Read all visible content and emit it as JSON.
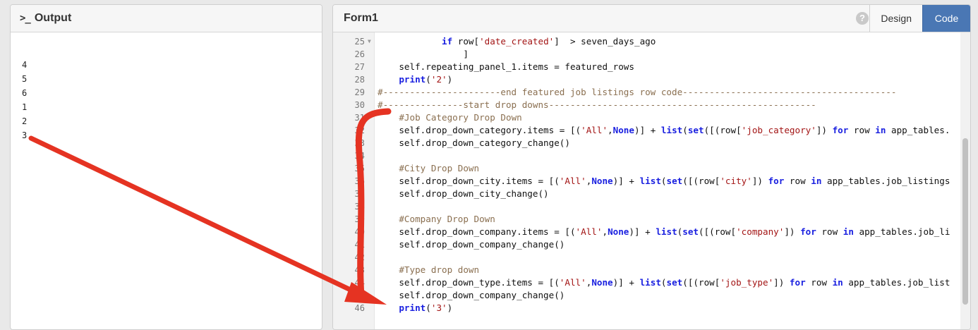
{
  "output": {
    "icon": ">_",
    "title": "Output",
    "lines": [
      "4",
      "5",
      "6",
      "1",
      "2",
      "3"
    ]
  },
  "form": {
    "title": "Form1",
    "help_icon": "?",
    "tabs": [
      {
        "label": "Design",
        "active": false
      },
      {
        "label": "Code",
        "active": true
      }
    ]
  },
  "editor": {
    "lines": [
      {
        "n": "25",
        "fold": true,
        "tokens": [
          [
            "txt",
            "            "
          ],
          [
            "kw",
            "if"
          ],
          [
            "txt",
            " row["
          ],
          [
            "str",
            "'date_created'"
          ],
          [
            "txt",
            "]  > seven_days_ago"
          ]
        ]
      },
      {
        "n": "26",
        "tokens": [
          [
            "txt",
            "                ]"
          ]
        ]
      },
      {
        "n": "27",
        "tokens": [
          [
            "txt",
            "    self.repeating_panel_1.items = featured_rows"
          ]
        ]
      },
      {
        "n": "28",
        "tokens": [
          [
            "txt",
            "    "
          ],
          [
            "fn",
            "print"
          ],
          [
            "txt",
            "("
          ],
          [
            "str",
            "'2'"
          ],
          [
            "txt",
            ")"
          ]
        ]
      },
      {
        "n": "29",
        "tokens": [
          [
            "cm",
            "#----------------------end featured job listings row code----------------------------------------"
          ]
        ]
      },
      {
        "n": "30",
        "tokens": [
          [
            "cm",
            "#---------------start drop downs--------------------------------------------------"
          ]
        ]
      },
      {
        "n": "31",
        "tokens": [
          [
            "txt",
            "    "
          ],
          [
            "cm",
            "#Job Category Drop Down"
          ]
        ]
      },
      {
        "n": "32",
        "tokens": [
          [
            "txt",
            "    self.drop_down_category.items = [("
          ],
          [
            "str",
            "'All'"
          ],
          [
            "txt",
            ","
          ],
          [
            "kw",
            "None"
          ],
          [
            "txt",
            ")] + "
          ],
          [
            "fn",
            "list"
          ],
          [
            "txt",
            "("
          ],
          [
            "fn",
            "set"
          ],
          [
            "txt",
            "([(row["
          ],
          [
            "str",
            "'job_category'"
          ],
          [
            "txt",
            "]) "
          ],
          [
            "kw",
            "for"
          ],
          [
            "txt",
            " row "
          ],
          [
            "kw",
            "in"
          ],
          [
            "txt",
            " app_tables."
          ]
        ]
      },
      {
        "n": "33",
        "tokens": [
          [
            "txt",
            "    self.drop_down_category_change()"
          ]
        ]
      },
      {
        "n": "34",
        "tokens": []
      },
      {
        "n": "35",
        "tokens": [
          [
            "txt",
            "    "
          ],
          [
            "cm",
            "#City Drop Down"
          ]
        ]
      },
      {
        "n": "36",
        "tokens": [
          [
            "txt",
            "    self.drop_down_city.items = [("
          ],
          [
            "str",
            "'All'"
          ],
          [
            "txt",
            ","
          ],
          [
            "kw",
            "None"
          ],
          [
            "txt",
            ")] + "
          ],
          [
            "fn",
            "list"
          ],
          [
            "txt",
            "("
          ],
          [
            "fn",
            "set"
          ],
          [
            "txt",
            "([(row["
          ],
          [
            "str",
            "'city'"
          ],
          [
            "txt",
            "]) "
          ],
          [
            "kw",
            "for"
          ],
          [
            "txt",
            " row "
          ],
          [
            "kw",
            "in"
          ],
          [
            "txt",
            " app_tables.job_listings"
          ]
        ]
      },
      {
        "n": "37",
        "tokens": [
          [
            "txt",
            "    self.drop_down_city_change()"
          ]
        ]
      },
      {
        "n": "38",
        "tokens": []
      },
      {
        "n": "39",
        "tokens": [
          [
            "txt",
            "    "
          ],
          [
            "cm",
            "#Company Drop Down"
          ]
        ]
      },
      {
        "n": "40",
        "tokens": [
          [
            "txt",
            "    self.drop_down_company.items = [("
          ],
          [
            "str",
            "'All'"
          ],
          [
            "txt",
            ","
          ],
          [
            "kw",
            "None"
          ],
          [
            "txt",
            ")] + "
          ],
          [
            "fn",
            "list"
          ],
          [
            "txt",
            "("
          ],
          [
            "fn",
            "set"
          ],
          [
            "txt",
            "([(row["
          ],
          [
            "str",
            "'company'"
          ],
          [
            "txt",
            "]) "
          ],
          [
            "kw",
            "for"
          ],
          [
            "txt",
            " row "
          ],
          [
            "kw",
            "in"
          ],
          [
            "txt",
            " app_tables.job_li"
          ]
        ]
      },
      {
        "n": "41",
        "tokens": [
          [
            "txt",
            "    self.drop_down_company_change()"
          ]
        ]
      },
      {
        "n": "42",
        "tokens": []
      },
      {
        "n": "43",
        "tokens": [
          [
            "txt",
            "    "
          ],
          [
            "cm",
            "#Type drop down"
          ]
        ]
      },
      {
        "n": "44",
        "tokens": [
          [
            "txt",
            "    self.drop_down_type.items = [("
          ],
          [
            "str",
            "'All'"
          ],
          [
            "txt",
            ","
          ],
          [
            "kw",
            "None"
          ],
          [
            "txt",
            ")] + "
          ],
          [
            "fn",
            "list"
          ],
          [
            "txt",
            "("
          ],
          [
            "fn",
            "set"
          ],
          [
            "txt",
            "([(row["
          ],
          [
            "str",
            "'job_type'"
          ],
          [
            "txt",
            "]) "
          ],
          [
            "kw",
            "for"
          ],
          [
            "txt",
            " row "
          ],
          [
            "kw",
            "in"
          ],
          [
            "txt",
            " app_tables.job_list"
          ]
        ]
      },
      {
        "n": "45",
        "tokens": [
          [
            "txt",
            "    self.drop_down_company_change()"
          ]
        ]
      },
      {
        "n": "46",
        "tokens": [
          [
            "txt",
            "    "
          ],
          [
            "fn",
            "print"
          ],
          [
            "txt",
            "("
          ],
          [
            "str",
            "'3'"
          ],
          [
            "txt",
            ")"
          ]
        ]
      }
    ]
  },
  "colors": {
    "keyword": "#1a20e0",
    "string": "#a31515",
    "comment": "#8a6f50",
    "annotation_arrow": "#e53322",
    "active_tab": "#4a77b4"
  }
}
